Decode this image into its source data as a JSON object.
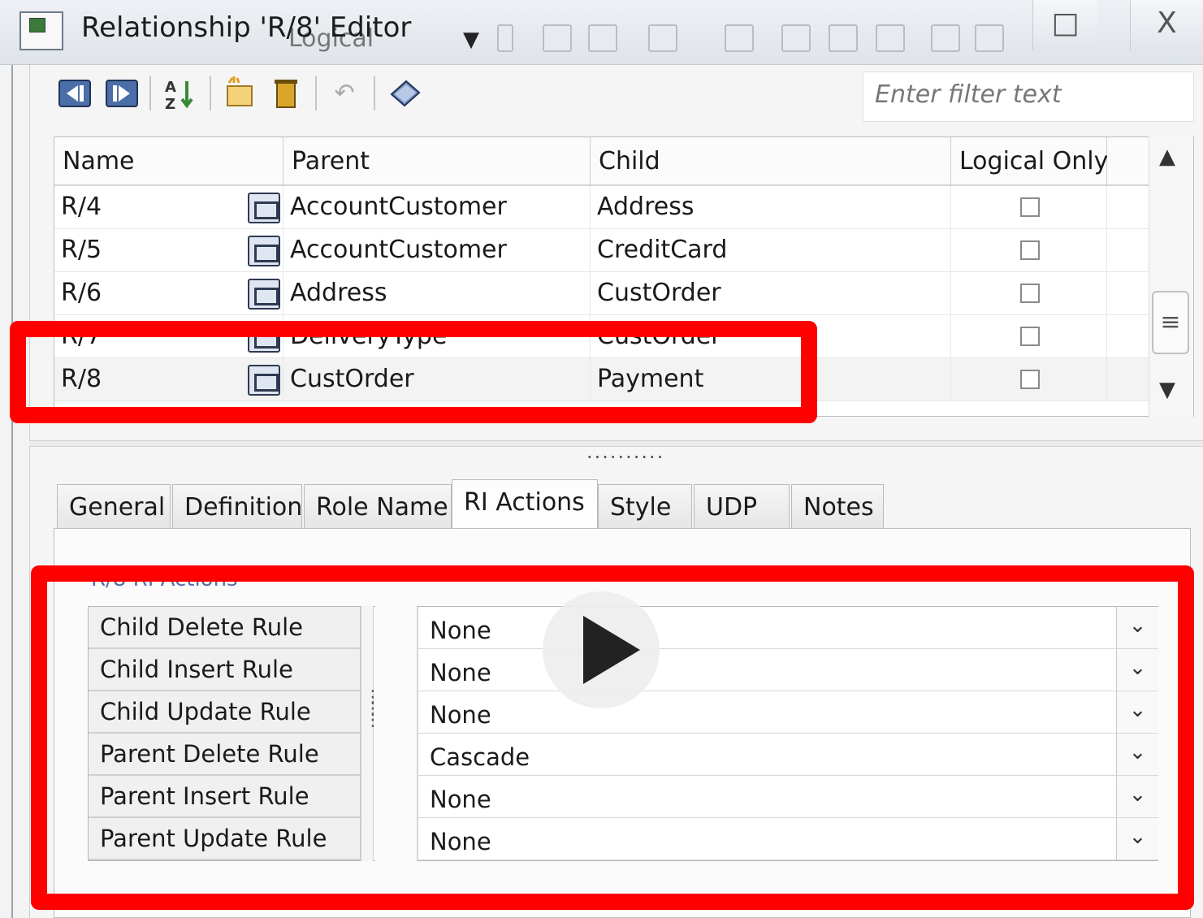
{
  "window": {
    "title": "Relationship 'R/8' Editor",
    "view_selector": "Logical",
    "controls": [
      "□",
      "X"
    ]
  },
  "toolbar": {
    "icons": [
      "move-first-icon",
      "move-last-icon",
      "sort-az-icon",
      "new-icon",
      "delete-icon",
      "undo-icon",
      "properties-icon"
    ],
    "filter_placeholder": "Enter filter text"
  },
  "grid": {
    "columns": [
      "Name",
      "Parent",
      "Child",
      "Logical Only"
    ],
    "rows": [
      {
        "name": "R/4",
        "parent": "AccountCustomer",
        "child": "Address",
        "logical_only": false
      },
      {
        "name": "R/5",
        "parent": "AccountCustomer",
        "child": "CreditCard",
        "logical_only": false
      },
      {
        "name": "R/6",
        "parent": "Address",
        "child": "CustOrder",
        "logical_only": false
      },
      {
        "name": "R/7",
        "parent": "DeliveryType",
        "child": "CustOrder",
        "logical_only": false
      },
      {
        "name": "R/8",
        "parent": "CustOrder",
        "child": "Payment",
        "logical_only": false
      }
    ]
  },
  "splitter_grip": "..........",
  "tabs": [
    {
      "label": "General",
      "active": false
    },
    {
      "label": "Definition",
      "active": false
    },
    {
      "label": "Role Name",
      "active": false
    },
    {
      "label": "RI Actions",
      "active": true
    },
    {
      "label": "Style",
      "active": false
    },
    {
      "label": "UDP",
      "active": false
    },
    {
      "label": "Notes",
      "active": false
    }
  ],
  "ri_actions": {
    "section_title": "R/8 RI Actions",
    "rules": [
      {
        "label": "Child Delete Rule",
        "value": "None"
      },
      {
        "label": "Child Insert Rule",
        "value": "None"
      },
      {
        "label": "Child Update Rule",
        "value": "None"
      },
      {
        "label": "Parent Delete Rule",
        "value": "Cascade"
      },
      {
        "label": "Parent Insert Rule",
        "value": "None"
      },
      {
        "label": "Parent Update Rule",
        "value": "None"
      }
    ]
  },
  "overlay": {
    "highlight_color": "#ff0000",
    "play_button": "play-icon"
  }
}
